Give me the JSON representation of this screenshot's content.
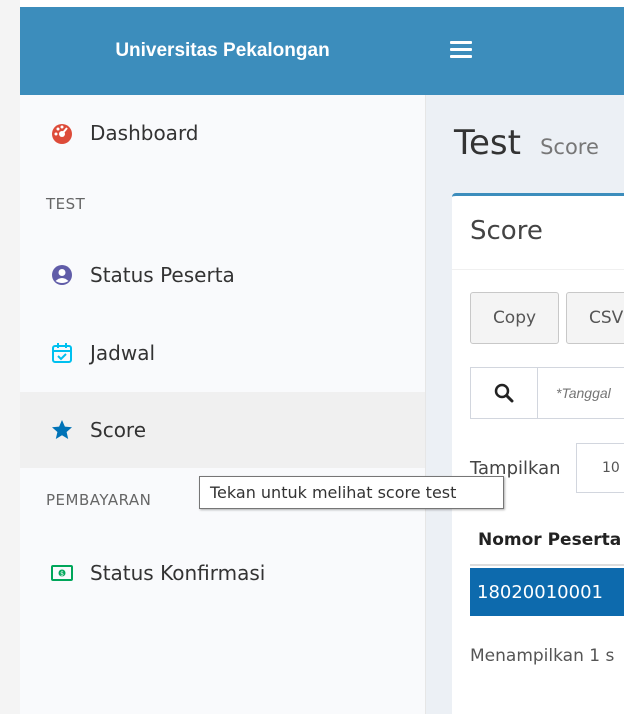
{
  "header": {
    "brand": "Universitas Pekalongan",
    "color": "#3c8dbc"
  },
  "sidebar": {
    "items": [
      {
        "label": "Dashboard",
        "icon": "dashboard-icon",
        "icon_color": "#dd4b39"
      },
      {
        "label": "Status Peserta",
        "icon": "user-circle-icon",
        "icon_color": "#605ca8"
      },
      {
        "label": "Jadwal",
        "icon": "calendar-check-icon",
        "icon_color": "#00c0ef"
      },
      {
        "label": "Score",
        "icon": "star-icon",
        "icon_color": "#0073b7",
        "active": true
      },
      {
        "label": "Status Konfirmasi",
        "icon": "money-icon",
        "icon_color": "#00a65a"
      }
    ],
    "sections": {
      "test": "TEST",
      "payment": "PEMBAYARAN"
    }
  },
  "content": {
    "title": "Test",
    "subtitle": "Score",
    "box_title": "Score",
    "buttons": {
      "copy": "Copy",
      "csv": "CSV"
    },
    "search": {
      "placeholder": "*Tanggal",
      "icon": "search-icon"
    },
    "length_label": "Tampilkan",
    "length_value": "10",
    "table": {
      "headers": [
        "Nomor Peserta"
      ],
      "rows": [
        [
          "18020010001"
        ]
      ]
    },
    "info": "Menampilkan 1 s"
  },
  "tooltip": "Tekan untuk melihat score test"
}
